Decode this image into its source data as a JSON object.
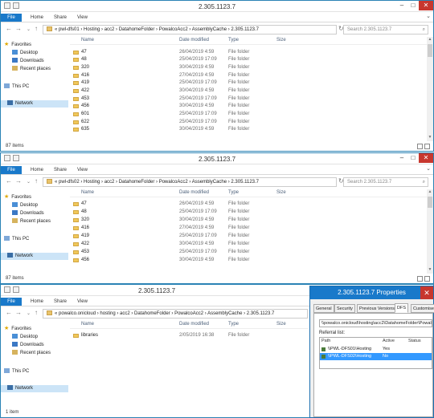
{
  "windows": [
    {
      "title": "2.305.1123.7",
      "ribbon_tabs": [
        "File",
        "Home",
        "Share",
        "View"
      ],
      "address_segments": [
        "pwl-dfs01",
        "Hosting",
        "acc2",
        "DatahomeFolder",
        "PowalcoAcc2",
        "AssemblyCache",
        "2.305.1123.7"
      ],
      "address_text": "«  pwl-dfs01  ›  Hosting  ›  acc2  ›  DatahomeFolder  ›  PowalcoAcc2  ›  AssemblyCache  ›  2.305.1123.7",
      "search_placeholder": "Search 2.305.1123.7",
      "columns": [
        "Name",
        "Date modified",
        "Type",
        "Size"
      ],
      "rows": [
        {
          "name": "47",
          "date": "26/04/2019 4:59",
          "type": "File folder"
        },
        {
          "name": "48",
          "date": "25/04/2019 17:09",
          "type": "File folder"
        },
        {
          "name": "320",
          "date": "30/04/2019 4:59",
          "type": "File folder"
        },
        {
          "name": "416",
          "date": "27/04/2019 4:59",
          "type": "File folder"
        },
        {
          "name": "419",
          "date": "25/04/2019 17:09",
          "type": "File folder"
        },
        {
          "name": "422",
          "date": "30/04/2019 4:59",
          "type": "File folder"
        },
        {
          "name": "453",
          "date": "25/04/2019 17:09",
          "type": "File folder"
        },
        {
          "name": "456",
          "date": "30/04/2019 4:59",
          "type": "File folder"
        },
        {
          "name": "601",
          "date": "25/04/2019 17:09",
          "type": "File folder"
        },
        {
          "name": "622",
          "date": "25/04/2019 17:09",
          "type": "File folder"
        },
        {
          "name": "635",
          "date": "30/04/2019 4:59",
          "type": "File folder"
        }
      ],
      "status": "87 items"
    },
    {
      "title": "2.305.1123.7",
      "ribbon_tabs": [
        "File",
        "Home",
        "Share",
        "View"
      ],
      "address_text": "«  pwl-dfs02  ›  Hosting  ›  acc2  ›  DatahomeFolder  ›  PowalcoAcc2  ›  AssemblyCache  ›  2.305.1123.7",
      "search_placeholder": "Search 2.305.1123.7",
      "columns": [
        "Name",
        "Date modified",
        "Type",
        "Size"
      ],
      "rows": [
        {
          "name": "47",
          "date": "26/04/2019 4:59",
          "type": "File folder"
        },
        {
          "name": "48",
          "date": "25/04/2019 17:09",
          "type": "File folder"
        },
        {
          "name": "320",
          "date": "30/04/2019 4:59",
          "type": "File folder"
        },
        {
          "name": "416",
          "date": "27/04/2019 4:59",
          "type": "File folder"
        },
        {
          "name": "419",
          "date": "25/04/2019 17:09",
          "type": "File folder"
        },
        {
          "name": "422",
          "date": "30/04/2019 4:59",
          "type": "File folder"
        },
        {
          "name": "453",
          "date": "25/04/2019 17:09",
          "type": "File folder"
        },
        {
          "name": "456",
          "date": "30/04/2019 4:59",
          "type": "File folder"
        }
      ],
      "status": "87 items"
    },
    {
      "title": "2.305.1123.7",
      "ribbon_tabs": [
        "File",
        "Home",
        "Share",
        "View"
      ],
      "address_text": "«  powalco.onicloud  ›  hosting  ›  acc2  ›  DatahomeFolder  ›  PowalcoAcc2  ›  AssemblyCache  ›  2.305.1123.7",
      "columns": [
        "Name",
        "Date modified",
        "Type",
        "Size"
      ],
      "rows": [
        {
          "name": "libraries",
          "date": "2/05/2019 16:38",
          "type": "File folder"
        }
      ],
      "status": "1 item"
    }
  ],
  "nav": {
    "favorites": "Favorites",
    "desktop": "Desktop",
    "downloads": "Downloads",
    "recent": "Recent places",
    "this_pc": "This PC",
    "network": "Network"
  },
  "dialog": {
    "title": "2.305.1123.7 Properties",
    "tabs": [
      "General",
      "Security",
      "Previous Versions",
      "DFS",
      "Customise"
    ],
    "active_tab": "DFS",
    "path": "\\\\powalco.onicloud\\hosting\\acc2\\DatahomeFolder\\Powalco",
    "referral_label": "Referral list:",
    "columns": [
      "Path",
      "Active",
      "Status"
    ],
    "referrals": [
      {
        "path": "\\\\PWL-DFS01\\Hosting",
        "active": "Yes",
        "status": ""
      },
      {
        "path": "\\\\PWL-DFS02\\Hosting",
        "active": "No",
        "status": ""
      }
    ]
  },
  "colors": {
    "accent": "#1979ca",
    "close": "#c7372e",
    "selection": "#cce4f7"
  }
}
